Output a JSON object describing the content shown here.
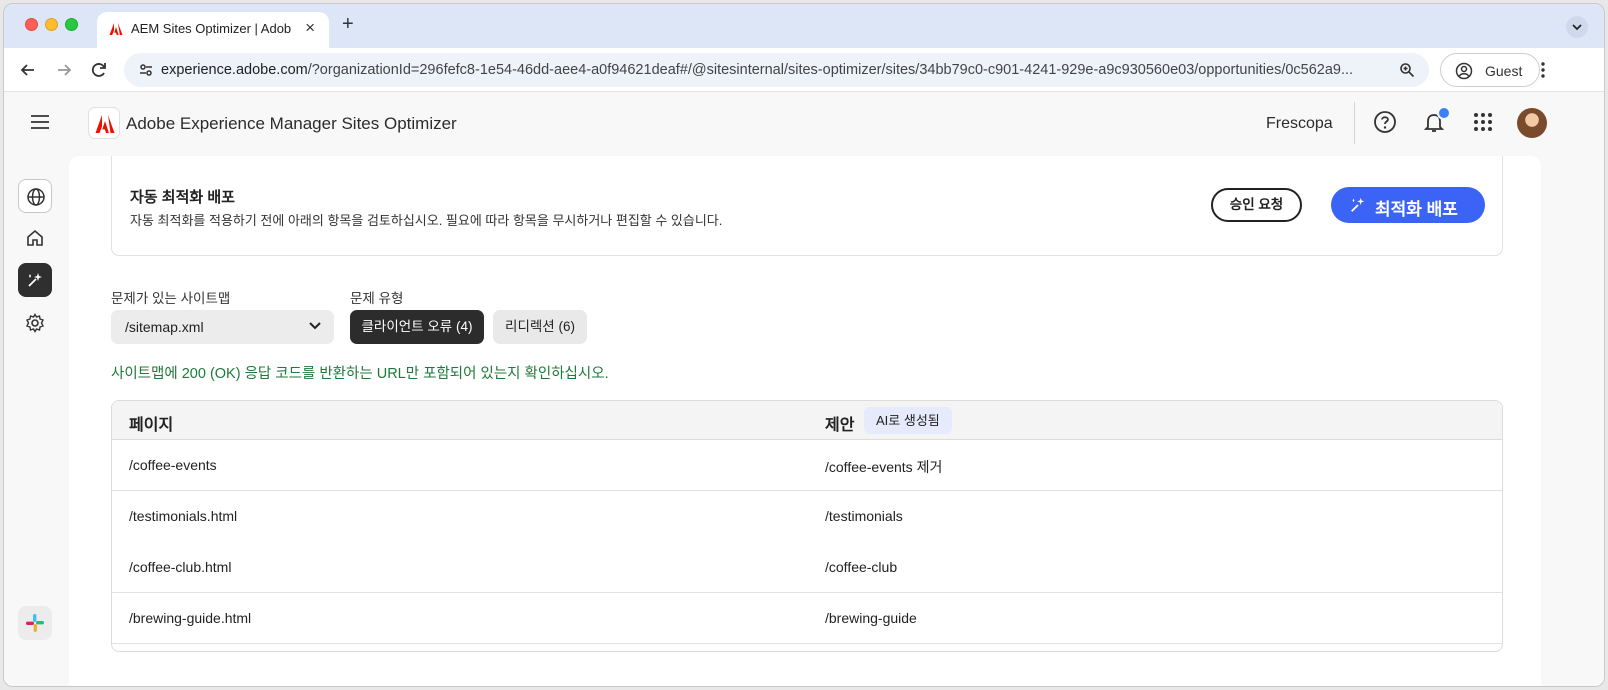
{
  "browser": {
    "tab_title": "AEM Sites Optimizer | Adobe",
    "url_host": "experience.adobe.com",
    "url_path": "/?organizationId=296fefc8-1e54-46dd-aee4-a0f94621deaf#/@sitesinternal/sites-optimizer/sites/34bb79c0-c901-4241-929e-a9c930560e03/opportunities/0c562a9...",
    "profile_label": "Guest"
  },
  "app": {
    "title": "Adobe Experience Manager Sites Optimizer",
    "org_name": "Frescopa"
  },
  "deploy": {
    "title": "자동 최적화 배포",
    "description": "자동 최적화를 적용하기 전에 아래의 항목을 검토하십시오. 필요에 따라 항목을 무시하거나 편집할 수 있습니다.",
    "approve_label": "승인 요청",
    "deploy_label": "최적화 배포"
  },
  "filters": {
    "sitemap_label": "문제가 있는 사이트맵",
    "sitemap_value": "/sitemap.xml",
    "issue_type_label": "문제 유형",
    "chip_client_error": "클라이언트 오류 (4)",
    "chip_redirect": "리디렉션 (6)"
  },
  "hint": "사이트맵에 200 (OK) 응답 코드를 반환하는 URL만 포함되어 있는지 확인하십시오.",
  "table": {
    "col_page": "페이지",
    "col_suggestion": "제안",
    "ai_badge": "AI로 생성됨",
    "rows": [
      {
        "page": "/coffee-events",
        "suggestion": "/coffee-events 제거"
      },
      {
        "page": "/testimonials.html",
        "suggestion": "/testimonials"
      },
      {
        "page": "/coffee-club.html",
        "suggestion": "/coffee-club"
      },
      {
        "page": "/brewing-guide.html",
        "suggestion": "/brewing-guide"
      }
    ]
  },
  "colors": {
    "accent_blue": "#3b63f5",
    "hint_green": "#1e7a3a",
    "adobe_red": "#eb1000"
  }
}
